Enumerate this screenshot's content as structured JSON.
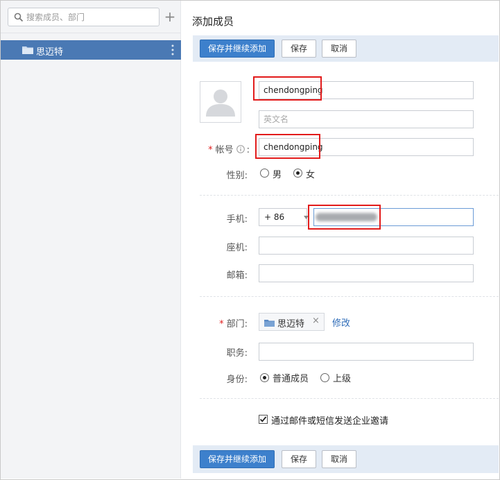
{
  "sidebar": {
    "search_placeholder": "搜索成员、部门",
    "add_symbol": "+",
    "departments": [
      {
        "label": "思迈特",
        "selected": true
      }
    ]
  },
  "page": {
    "title": "添加成员"
  },
  "toolbar": {
    "save_continue": "保存并继续添加",
    "save": "保存",
    "cancel": "取消"
  },
  "form": {
    "name_value": "chendongping",
    "english_name_placeholder": "英文名",
    "account_label": "帐号",
    "account_value": "chendongping",
    "gender_label": "性别:",
    "gender_options": [
      "男",
      "女"
    ],
    "gender_selected": "女",
    "mobile_label": "手机:",
    "country_code": "+ 86",
    "phone_label": "座机:",
    "email_label": "邮箱:",
    "dept_label": "部门",
    "dept_value": "思迈特",
    "dept_remove": "×",
    "dept_modify": "修改",
    "title_label": "职务:",
    "role_label": "身份:",
    "role_options": [
      "普通成员",
      "上级"
    ],
    "role_selected": "普通成员",
    "invite_text": "通过邮件或短信发送企业邀请",
    "invite_checked": true
  },
  "colors": {
    "accent": "#3d80cc",
    "sidebar_selected": "#4a79b4",
    "highlight": "#e21b1b",
    "link": "#2e6cb8",
    "required": "#e02020"
  }
}
